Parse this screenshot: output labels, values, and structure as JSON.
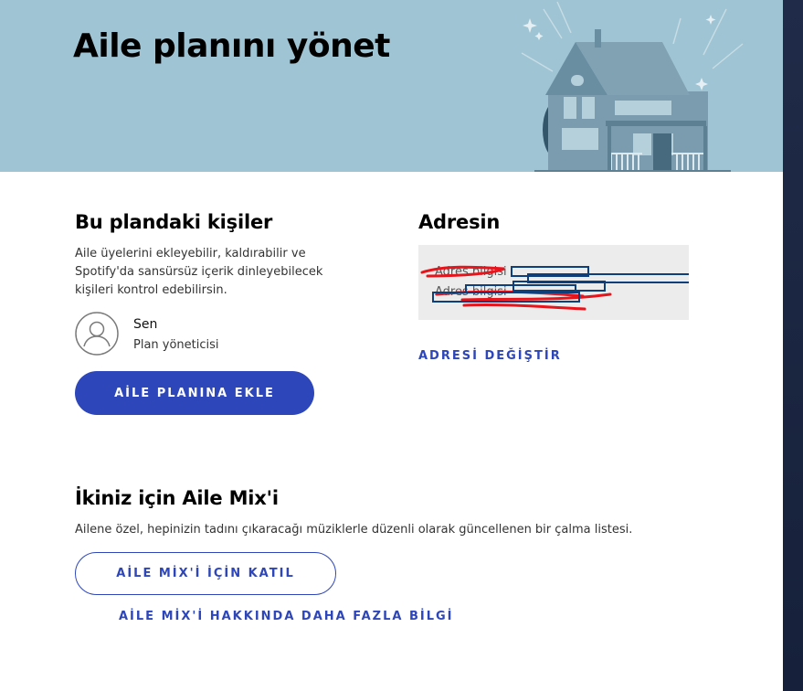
{
  "header": {
    "title": "Aile planını yönet"
  },
  "members_section": {
    "heading": "Bu plandaki kişiler",
    "description_lines": [
      "Aile üyelerini ekleyebilir, kaldırabilir ve",
      "Spotify'da sansürsüz içerik dinleyebilecek",
      "kişileri kontrol edebilirsin."
    ],
    "members": [
      {
        "name": "Sen",
        "role": "Plan yöneticisi"
      }
    ],
    "add_button_label": "AİLE PLANINA EKLE"
  },
  "address_section": {
    "heading": "Adresin",
    "lines": [
      "Adres bilgisi",
      "Adres bilgisi"
    ],
    "change_link_label": "ADRESİ DEĞİŞTİR"
  },
  "mix_section": {
    "heading": "İkiniz için Aile Mix'i",
    "description": "Ailene özel, hepinizin tadını çıkaracağı müziklerle düzenli olarak güncellenen bir çalma listesi.",
    "join_button_label": "AİLE MİX'İ İÇİN KATIL",
    "learn_more_label": "AİLE MİX'İ HAKKINDA DAHA FAZLA BİLGİ"
  },
  "colors": {
    "banner_bg": "#9fc4d4",
    "accent": "#2d46b9",
    "address_bg": "#ececec",
    "sidebar_dark": "#1f2b48"
  }
}
